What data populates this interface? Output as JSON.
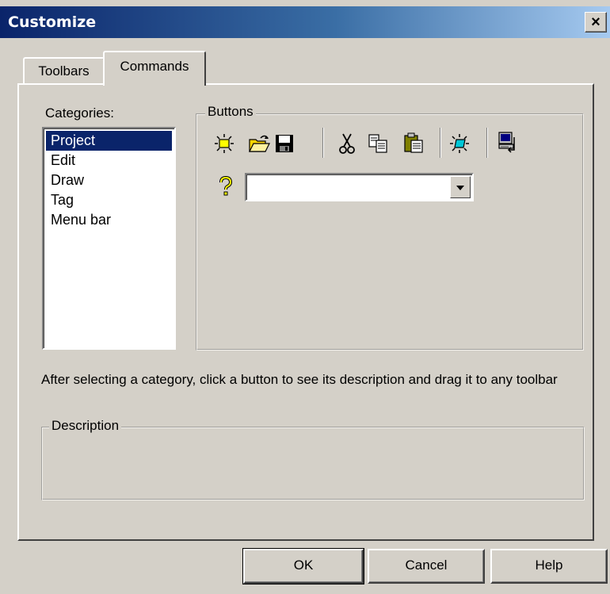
{
  "window": {
    "title": "Customize",
    "close_label": "×"
  },
  "tabs": [
    {
      "label": "Toolbars",
      "active": false
    },
    {
      "label": "Commands",
      "active": true
    }
  ],
  "categories": {
    "label": "Categories:",
    "items": [
      "Project",
      "Edit",
      "Draw",
      "Tag",
      "Menu bar"
    ],
    "selected": "Project"
  },
  "buttons_group": {
    "label": "Buttons",
    "icons": [
      "new-project-icon",
      "open-folder-icon",
      "save-disk-icon",
      "cut-scissors-icon",
      "copy-icon",
      "paste-clipboard-icon",
      "new-screen-icon",
      "computer-icon",
      "help-question-icon"
    ],
    "combo_value": ""
  },
  "hint_text": "After selecting a category, click a button to see its description and drag it to any toolbar",
  "description_group": {
    "label": "Description",
    "text": ""
  },
  "footer": {
    "ok_label": "OK",
    "cancel_label": "Cancel",
    "help_label": "Help"
  },
  "colors": {
    "title_bar": "#0a246a",
    "selection": "#0a246a",
    "face": "#d4d0c8"
  }
}
